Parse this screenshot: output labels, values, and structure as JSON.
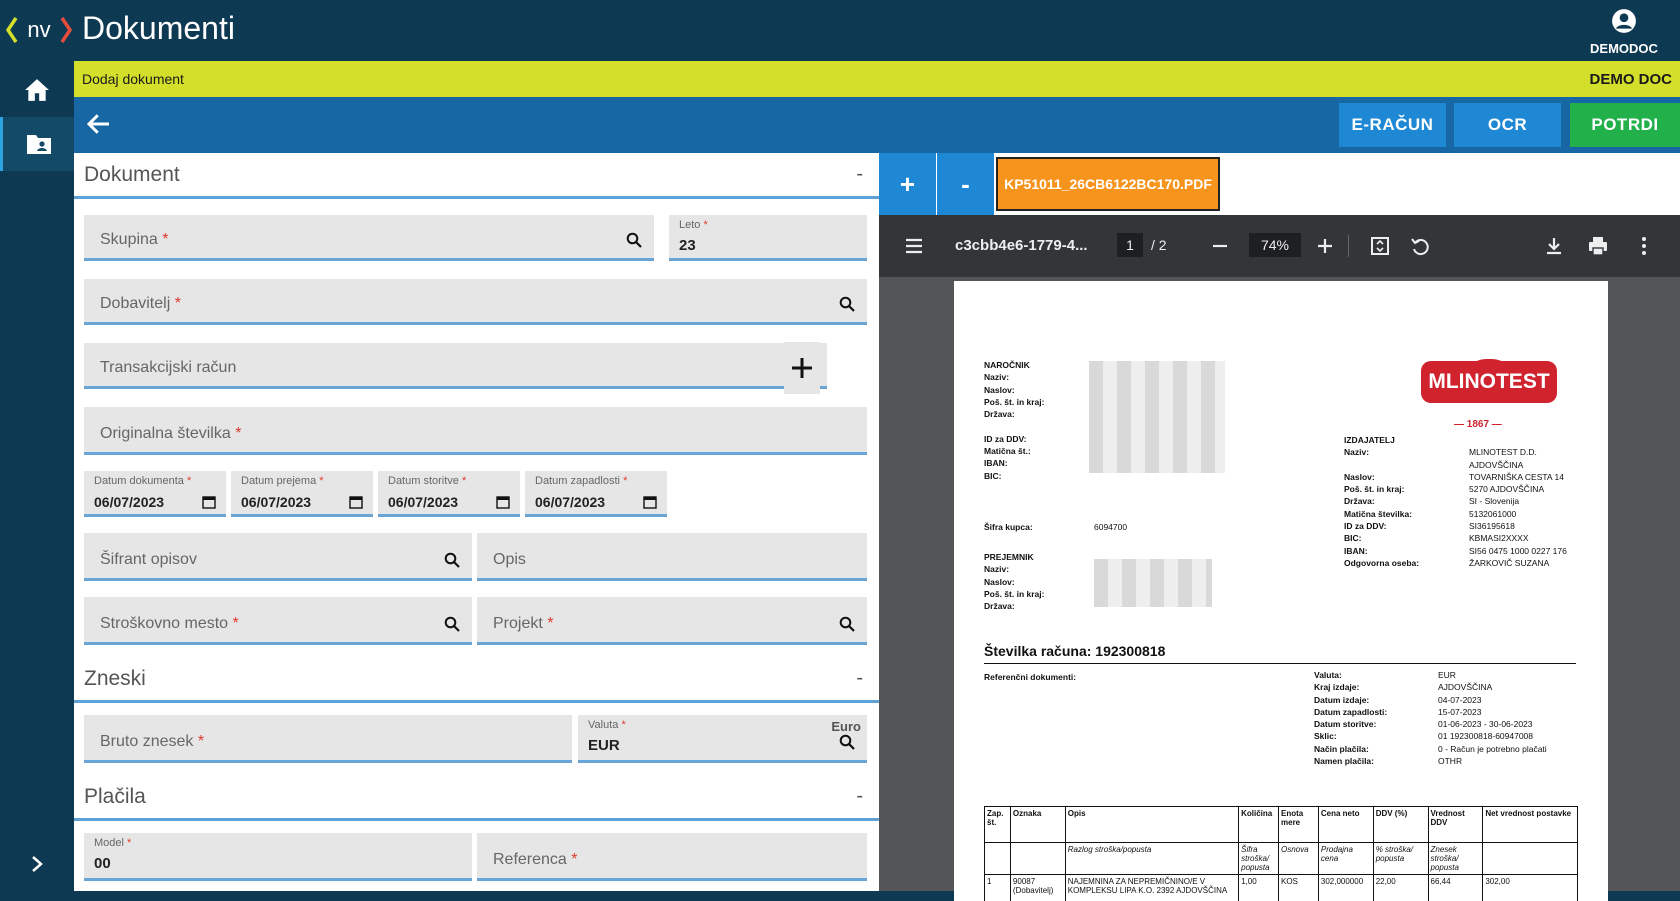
{
  "app": {
    "logo_text": "nv",
    "title": "Dokumenti",
    "user": "DEMODOC"
  },
  "nav": {
    "home": "home-icon",
    "docs": "folder-user-icon",
    "expand": "chevron-right-icon"
  },
  "subheader": {
    "left": "Dodaj dokument",
    "right": "DEMO DOC"
  },
  "toolbar": {
    "eracun": "E-RAČUN",
    "ocr": "OCR",
    "potrdi": "POTRDI"
  },
  "colors": {
    "header": "#0d3a52",
    "yellow": "#d4df2b",
    "blue": "#1667a3",
    "button_blue": "#1e88d4",
    "button_green": "#22b04b",
    "file_tab": "#f7941d"
  },
  "form": {
    "sections": {
      "dokument": "Dokument",
      "zneski": "Zneski",
      "placila": "Plačila"
    },
    "collapse": "-",
    "fields": {
      "skupina": "Skupina",
      "leto_label": "Leto",
      "leto_value": "23",
      "dobavitelj": "Dobavitelj",
      "transakcijski": "Transakcijski račun",
      "originalna": "Originalna številka",
      "datum_dokumenta": "Datum dokumenta",
      "datum_dokumenta_value": "06/07/2023",
      "datum_prejema": "Datum prejema",
      "datum_prejema_value": "06/07/2023",
      "datum_storitve": "Datum storitve",
      "datum_storitve_value": "06/07/2023",
      "datum_zapadlosti": "Datum zapadlosti",
      "datum_zapadlosti_value": "06/07/2023",
      "sifrant": "Šifrant opisov",
      "opis": "Opis",
      "strosek": "Stroškovno mesto",
      "projekt": "Projekt",
      "bruto": "Bruto znesek",
      "valuta_label": "Valuta",
      "valuta_value": "EUR",
      "valuta_name": "Euro",
      "model_label": "Model",
      "model_value": "00",
      "referenca": "Referenca"
    },
    "required_mark": "*",
    "add": "+"
  },
  "viewer": {
    "zoom_in": "+",
    "zoom_out": "-",
    "file_tab": "KP51011_26CB6122BC170.PDF",
    "pdf": {
      "filename": "c3cbb4e6-1779-4...",
      "page": "1",
      "total": "/ 2",
      "zoom": "74%"
    }
  },
  "invoice": {
    "narocnik_labels": [
      "NAROČNIK",
      "Naziv:",
      "Naslov:",
      "Poš. št. in kraj:",
      "Država:",
      "",
      "ID za DDV:",
      "Matična št.:",
      "IBAN:",
      "BIC:"
    ],
    "brand": "MLINOTEST",
    "brand_year": "— 1867 —",
    "izdajatelj_labels": [
      "IZDAJATELJ",
      "Naziv:",
      "",
      "Naslov:",
      "Poš. št. in kraj:",
      "Država:",
      "Matična številka:",
      "ID za DDV:",
      "BIC:",
      "IBAN:",
      "Odgovorna oseba:"
    ],
    "izdajatelj_values": [
      "",
      "MLINOTEST D.D.",
      "AJDOVŠČINA",
      "TOVARNIŠKA CESTA 14",
      "5270 AJDOVŠČINA",
      "SI - Slovenija",
      "5132061000",
      "SI36195618",
      "KBMASI2XXXX",
      "SI56 0475 1000 0227 176",
      "ŽARKOVIČ SUZANA"
    ],
    "sifra_kupca_label": "Šifra kupca:",
    "sifra_kupca": "6094700",
    "prejemnik_labels": [
      "PREJEMNIK",
      "Naziv:",
      "Naslov:",
      "Poš. št. in kraj:",
      "Država:"
    ],
    "stevilka_label": "Številka računa:",
    "stevilka": "192300818",
    "referencni": "Referenčni dokumenti:",
    "meta_labels": [
      "Valuta:",
      "Kraj izdaje:",
      "Datum izdaje:",
      "Datum zapadlosti:",
      "Datum storitve:",
      "Sklic:",
      "Način plačila:",
      "Namen plačila:"
    ],
    "meta_values": [
      "EUR",
      "AJDOVŠČINA",
      "04-07-2023",
      "15-07-2023",
      "01-06-2023 - 30-06-2023",
      "01 192300818-60947008",
      "0 - Račun je potrebno plačati",
      "OTHR"
    ],
    "table": {
      "headers": [
        "Zap. št.",
        "Oznaka",
        "Opis",
        "Količina",
        "Enota mere",
        "Cena neto",
        "DDV (%)",
        "Vrednost DDV",
        "Net vrednost postavke"
      ],
      "sub": [
        "",
        "",
        "Razlog stroška/popusta",
        "Šifra stroška/ popusta",
        "Osnova",
        "Prodajna cena",
        "% stroška/ popusta",
        "Znesek stroška/ popusta",
        ""
      ],
      "row": [
        "1",
        "90087 (Dobavitelj)",
        "NAJEMNINA ZA NEPREMIČNINO/E V KOMPLEKSU LIPA K.O. 2392 AJDOVŠČINA",
        "1,00",
        "KOS",
        "302,000000",
        "22,00",
        "66,44",
        "302,00"
      ]
    }
  }
}
